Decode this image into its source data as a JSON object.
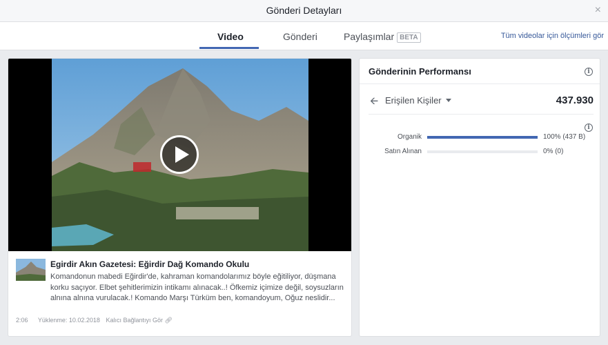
{
  "header": {
    "title": "Gönderi Detayları",
    "close_glyph": "×"
  },
  "tabs": [
    {
      "label": "Video",
      "active": true
    },
    {
      "label": "Gönderi",
      "active": false
    },
    {
      "label": "Paylaşımlar",
      "active": false,
      "badge": "BETA"
    }
  ],
  "all_videos_link": "Tüm videolar için ölçümleri gör",
  "post": {
    "title": "Egirdir Akın Gazetesi: Eğirdir Dağ Komando Okulu",
    "description": "Komandonun mabedi Eğirdir'de, kahraman komandolarımız böyle eğitiliyor, düşmana korku saçıyor. Elbet şehitlerimizin intikamı alınacak..! Öfkemiz içimize değil, soysuzların alnına alnına vurulacak.! Komando Marşı Türküm ben, komandoyum, Oğuz neslidir...",
    "duration": "2:06",
    "uploaded": "Yüklenme: 10.02.2018",
    "permalink": "Kalıcı Bağlantıyı Gör"
  },
  "performance": {
    "title": "Gönderinin Performansı",
    "metric_label": "Erişilen Kişiler",
    "metric_value": "437.930",
    "rows": [
      {
        "label": "Organik",
        "fraction": 1.0,
        "value_text": "100% (437 B)"
      },
      {
        "label": "Satın Alınan",
        "fraction": 0.0,
        "value_text": "0% (0)"
      }
    ]
  },
  "colors": {
    "accent": "#4267b2",
    "link": "#365899",
    "page_bg": "#e9ebee"
  },
  "icons": [
    "close-icon",
    "play-icon",
    "info-icon",
    "back-arrow-icon",
    "chevron-down-icon",
    "link-icon"
  ]
}
